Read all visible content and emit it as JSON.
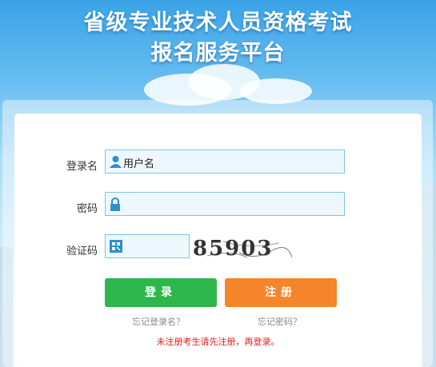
{
  "header": {
    "title_line1": "省级专业技术人员资格考试",
    "title_line2": "报名服务平台"
  },
  "form": {
    "username_label": "登录名",
    "username_placeholder": "用户名",
    "password_label": "密码",
    "captcha_label": "验证码",
    "captcha_text": "85903"
  },
  "buttons": {
    "login": "登录",
    "register": "注册"
  },
  "links": {
    "forgot_username": "忘记登录名？",
    "forgot_password": "忘记密码？"
  },
  "notice": "未注册考生请先注册，再登录。",
  "colors": {
    "login": "#2db64b",
    "register": "#f5852a",
    "notice": "#e0201b",
    "field_border": "#7fc4e4"
  }
}
